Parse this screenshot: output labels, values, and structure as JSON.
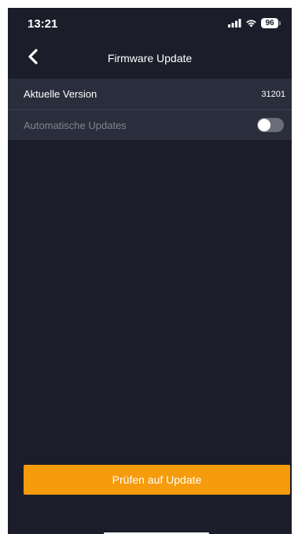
{
  "status_bar": {
    "time": "13:21",
    "battery_level": "96",
    "icons": [
      "cellular-signal-icon",
      "wifi-icon",
      "battery-icon"
    ]
  },
  "nav": {
    "title": "Firmware Update",
    "back_icon": "chevron-left-icon"
  },
  "settings": {
    "current_version": {
      "label": "Aktuelle Version",
      "value": "31201"
    },
    "auto_updates": {
      "label": "Automatische Updates",
      "enabled": false
    }
  },
  "actions": {
    "check_update_label": "Prüfen auf Update"
  },
  "colors": {
    "background": "#1b1e2a",
    "group_background": "#2a2e3c",
    "accent": "#f59b0c",
    "toggle_off": "#6b6e78"
  }
}
